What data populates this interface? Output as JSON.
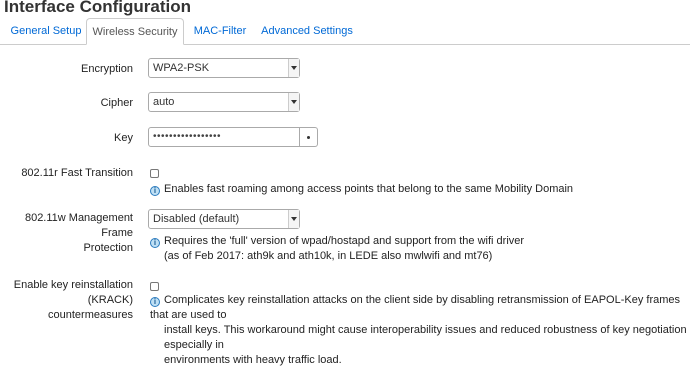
{
  "page": {
    "title": "Interface Configuration"
  },
  "tabs": [
    {
      "label": "General Setup",
      "active": false
    },
    {
      "label": "Wireless Security",
      "active": true
    },
    {
      "label": "MAC-Filter",
      "active": false
    },
    {
      "label": "Advanced Settings",
      "active": false
    }
  ],
  "form": {
    "encryption": {
      "label": "Encryption",
      "value": "WPA2-PSK"
    },
    "cipher": {
      "label": "Cipher",
      "value": "auto"
    },
    "key": {
      "label": "Key",
      "value": "•••••••••••••••••"
    },
    "fast_transition": {
      "label": "802.11r Fast Transition",
      "checked": false,
      "help": "Enables fast roaming among access points that belong to the same Mobility Domain"
    },
    "mgmt_frame": {
      "label_line1": "802.11w Management Frame",
      "label_line2": "Protection",
      "value": "Disabled (default)",
      "help_line1": "Requires the 'full' version of wpad/hostapd and support from the wifi driver",
      "help_line2": "(as of Feb 2017: ath9k and ath10k, in LEDE also mwlwifi and mt76)"
    },
    "krack": {
      "label_line1": "Enable key reinstallation",
      "label_line2": "(KRACK) countermeasures",
      "checked": false,
      "help_line1": "Complicates key reinstallation attacks on the client side by disabling retransmission of EAPOL-Key frames that are used to",
      "help_line2": "install keys. This workaround might cause interoperability issues and reduced robustness of key negotiation especially in",
      "help_line3": "environments with heavy traffic load."
    }
  },
  "icons": {
    "info": "info-icon",
    "dropdown": "chevron-down-icon",
    "reveal": "dot-icon"
  }
}
